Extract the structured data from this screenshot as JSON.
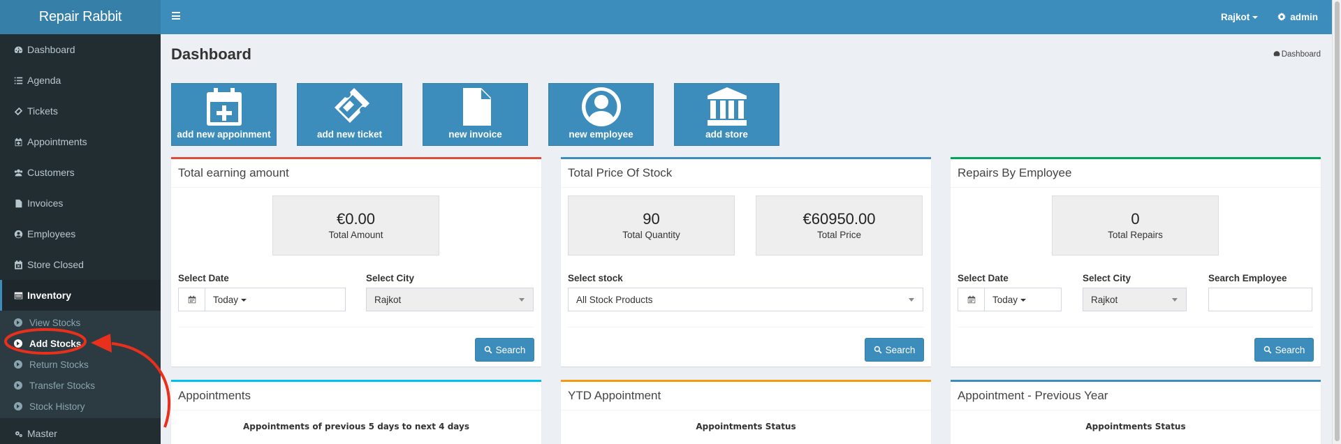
{
  "app": {
    "brand": "Repair Rabbit"
  },
  "sidebar": {
    "items": [
      {
        "label": "Dashboard",
        "icon": "dashboard-icon"
      },
      {
        "label": "Agenda",
        "icon": "list-icon"
      },
      {
        "label": "Tickets",
        "icon": "ticket-icon"
      },
      {
        "label": "Appointments",
        "icon": "calendar-plus-icon"
      },
      {
        "label": "Customers",
        "icon": "users-icon"
      },
      {
        "label": "Invoices",
        "icon": "file-icon"
      },
      {
        "label": "Employees",
        "icon": "user-circle-icon"
      },
      {
        "label": "Store Closed",
        "icon": "calendar-x-icon"
      },
      {
        "label": "Inventory",
        "icon": "list-alt-icon"
      }
    ],
    "inventory_sub": [
      "View Stocks",
      "Add Stocks",
      "Return Stocks",
      "Transfer Stocks",
      "Stock History"
    ],
    "master": {
      "label": "Master",
      "icon": "cogs-icon"
    }
  },
  "topbar": {
    "location": "Rajkot",
    "user": "admin"
  },
  "page": {
    "title": "Dashboard",
    "breadcrumb": "Dashboard"
  },
  "quick_actions": [
    "add new appoinment",
    "add new ticket",
    "new invoice",
    "new employee",
    "add store"
  ],
  "earning": {
    "title": "Total earning amount",
    "amount": "€0.00",
    "amount_label": "Total Amount",
    "date_label": "Select Date",
    "date_value": "Today",
    "city_label": "Select City",
    "city_value": "Rajkot",
    "search": "Search"
  },
  "stock": {
    "title": "Total Price Of Stock",
    "qty": "90",
    "qty_label": "Total Quantity",
    "price": "€60950.00",
    "price_label": "Total Price",
    "select_label": "Select stock",
    "select_value": "All Stock Products",
    "search": "Search"
  },
  "repairs": {
    "title": "Repairs By Employee",
    "count": "0",
    "count_label": "Total Repairs",
    "date_label": "Select Date",
    "date_value": "Today",
    "city_label": "Select City",
    "city_value": "Rajkot",
    "emp_label": "Search Employee",
    "search": "Search"
  },
  "bottom": [
    {
      "title": "Appointments",
      "sub": "Appointments of previous 5 days to next 4 days"
    },
    {
      "title": "YTD Appointment",
      "sub": "Appointments Status"
    },
    {
      "title": "Appointment - Previous Year",
      "sub": "Appointments Status"
    }
  ],
  "colors": {
    "primary": "#3c8dbc",
    "sidebar": "#222d32",
    "annotation": "#e8301c"
  }
}
